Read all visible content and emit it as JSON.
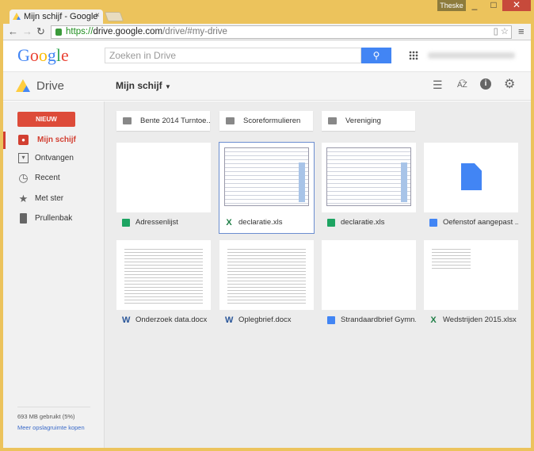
{
  "browser": {
    "tab_title": "Mijn schijf - Google",
    "user": "Theske",
    "url_scheme": "https://",
    "url_host": "drive.google.com",
    "url_path": "/drive/#my-drive"
  },
  "header": {
    "logo": "Google",
    "search_placeholder": "Zoeken in Drive",
    "app_name": "Drive",
    "location": "Mijn schijf"
  },
  "sidebar": {
    "new_label": "NIEUW",
    "items": [
      {
        "label": "Mijn schijf",
        "icon": "drive-folder-icon"
      },
      {
        "label": "Ontvangen",
        "icon": "inbox-icon"
      },
      {
        "label": "Recent",
        "icon": "clock-icon"
      },
      {
        "label": "Met ster",
        "icon": "star-icon"
      },
      {
        "label": "Prullenbak",
        "icon": "trash-icon"
      }
    ],
    "quota": "693 MB gebruikt (5%)",
    "buy_link": "Meer opslagruimte kopen"
  },
  "folders": [
    {
      "name": "Bente 2014 Turntoe..."
    },
    {
      "name": "Scoreformulieren"
    },
    {
      "name": "Vereniging"
    }
  ],
  "files": [
    {
      "name": "Adressenlijst",
      "type": "sheets"
    },
    {
      "name": "declaratie.xls",
      "type": "excel"
    },
    {
      "name": "declaratie.xls",
      "type": "sheets"
    },
    {
      "name": "Oefenstof aangepast ...",
      "type": "docs"
    },
    {
      "name": "Onderzoek data.docx",
      "type": "word"
    },
    {
      "name": "Oplegbrief.docx",
      "type": "word"
    },
    {
      "name": "Strandaardbrief Gymn...",
      "type": "docs"
    },
    {
      "name": "Wedstrijden 2015.xlsx",
      "type": "excel"
    }
  ]
}
